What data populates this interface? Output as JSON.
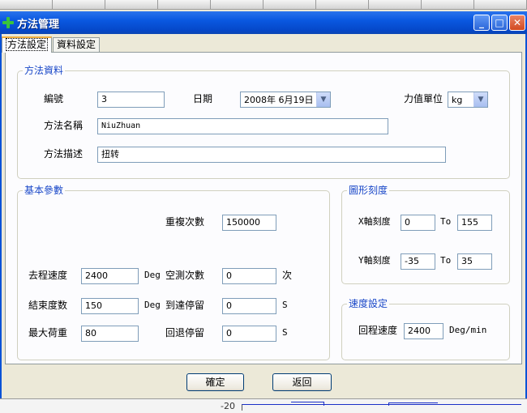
{
  "window": {
    "title": "方法管理"
  },
  "tabs": [
    {
      "label": "方法設定"
    },
    {
      "label": "資料設定"
    }
  ],
  "method_info": {
    "group_title": "方法資料",
    "number_label": "編號",
    "number_value": "3",
    "date_label": "日期",
    "date_value": "2008年 6月19日",
    "force_unit_label": "力值單位",
    "force_unit_value": "kg",
    "name_label": "方法名稱",
    "name_value": "NiuZhuan",
    "desc_label": "方法描述",
    "desc_value": "扭转"
  },
  "basic_params": {
    "group_title": "基本參數",
    "repeat_label": "重複次數",
    "repeat_value": "150000",
    "out_speed_label": "去程速度",
    "out_speed_value": "2400",
    "out_speed_unit": "Deg",
    "idle_count_label": "空測次數",
    "idle_count_value": "0",
    "idle_count_unit": "次",
    "end_degree_label": "結束度数",
    "end_degree_value": "150",
    "end_degree_unit": "Deg",
    "arrive_dwell_label": "到達停留",
    "arrive_dwell_value": "0",
    "arrive_dwell_unit": "S",
    "max_load_label": "最大荷重",
    "max_load_value": "80",
    "return_dwell_label": "回退停留",
    "return_dwell_value": "0",
    "return_dwell_unit": "S"
  },
  "graph_scale": {
    "group_title": "圖形刻度",
    "x_label": "X軸刻度",
    "x_from": "0",
    "x_to_label": "To",
    "x_to": "155",
    "y_label": "Y軸刻度",
    "y_from": "-35",
    "y_to_label": "To",
    "y_to": "35"
  },
  "speed_settings": {
    "group_title": "速度設定",
    "return_speed_label": "回程速度",
    "return_speed_value": "2400",
    "return_speed_unit": "Deg/min"
  },
  "buttons": {
    "confirm": "確定",
    "back": "返回"
  },
  "background": {
    "axis_tick": "-20"
  },
  "colors": {
    "titlebar": "#0a58e0",
    "group_title": "#1a48c8",
    "dialog_bg": "#ece9d8"
  }
}
